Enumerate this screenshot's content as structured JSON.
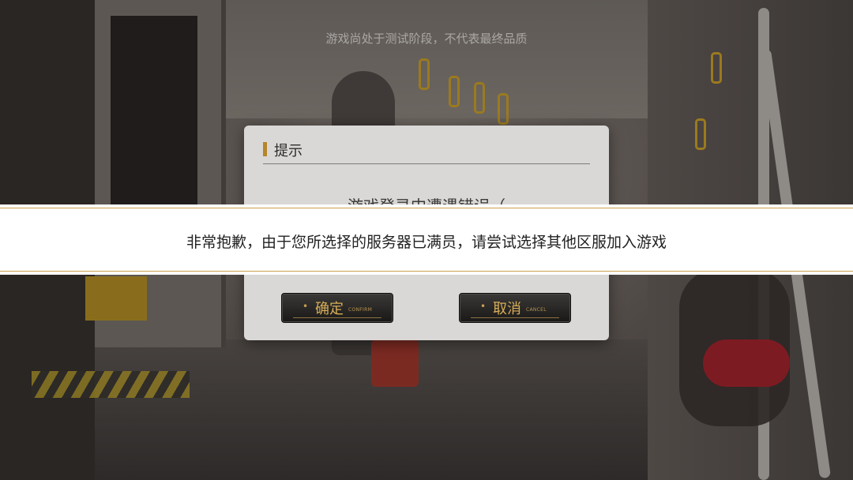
{
  "watermark": "游戏尚处于测试阶段，不代表最终品质",
  "dialog": {
    "title": "提示",
    "message": "游戏登录中遭遇错误（",
    "confirm": {
      "label": "确定",
      "sub": "CONFIRM"
    },
    "cancel": {
      "label": "取消",
      "sub": "CANCEL"
    }
  },
  "toast": {
    "message": "非常抱歉，由于您所选择的服务器已满员，请尝试选择其他区服加入游戏"
  },
  "colors": {
    "accent_gold": "#c9a04e",
    "dialog_bg": "#d9d8d6",
    "button_bg": "#1f1e1d"
  }
}
